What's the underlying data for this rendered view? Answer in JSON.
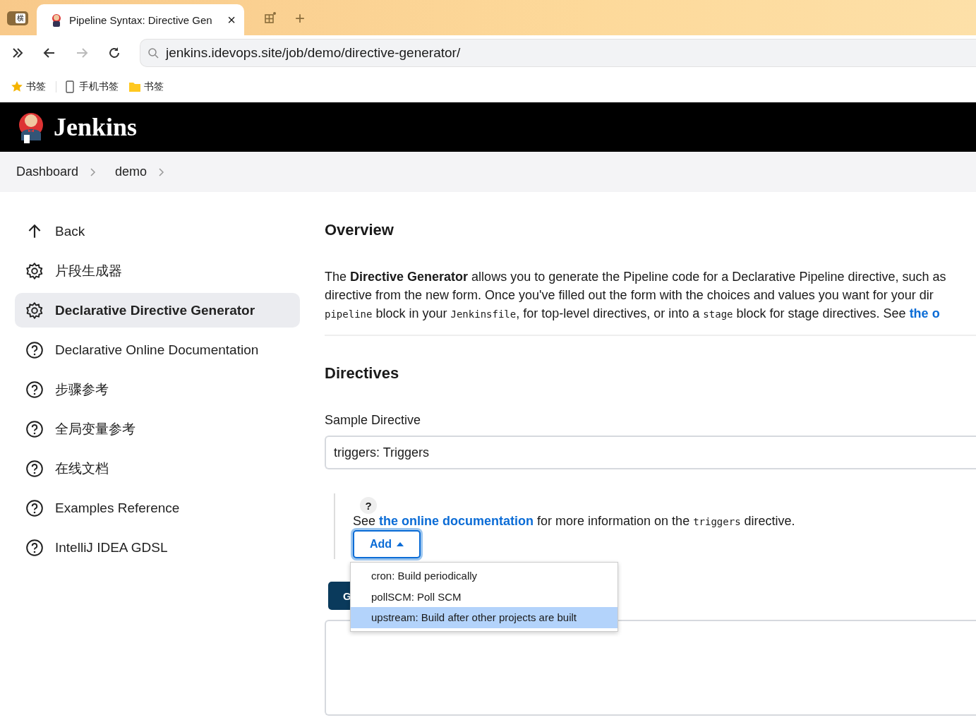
{
  "browser": {
    "tab": {
      "title": "Pipeline Syntax: Directive Gen",
      "close": "×"
    },
    "side_tab": "横",
    "new_tab": "+",
    "address": "jenkins.idevops.site/job/demo/directive-generator/",
    "bookmarks": [
      {
        "kind": "star",
        "label": "书签"
      },
      {
        "kind": "phone",
        "label": "手机书签"
      },
      {
        "kind": "folder",
        "label": "书签"
      }
    ]
  },
  "header": {
    "title": "Jenkins"
  },
  "breadcrumbs": [
    "Dashboard",
    "demo"
  ],
  "sidebar": {
    "items": [
      {
        "kind": "back",
        "label": "Back",
        "selected": false
      },
      {
        "kind": "generator",
        "label": "片段生成器",
        "selected": false
      },
      {
        "kind": "generator",
        "label": "Declarative Directive Generator",
        "selected": true
      },
      {
        "kind": "doc",
        "label": "Declarative Online Documentation",
        "selected": false
      },
      {
        "kind": "doc",
        "label": "步骤参考",
        "selected": false
      },
      {
        "kind": "doc",
        "label": "全局变量参考",
        "selected": false
      },
      {
        "kind": "doc",
        "label": "在线文档",
        "selected": false
      },
      {
        "kind": "doc",
        "label": "Examples Reference",
        "selected": false
      },
      {
        "kind": "doc",
        "label": "IntelliJ IDEA GDSL",
        "selected": false
      }
    ]
  },
  "overview": {
    "title": "Overview",
    "lines": [
      [
        {
          "kind": "text",
          "text": "The "
        },
        {
          "kind": "bold",
          "text": "Directive Generator"
        },
        {
          "kind": "text",
          "text": " allows you to generate the Pipeline code for a Declarative Pipeline directive, such as"
        }
      ],
      [
        {
          "kind": "text",
          "text": "directive from the new form. Once you've filled out the form with the choices and values you want for your dir"
        }
      ],
      [
        {
          "kind": "code",
          "text": "pipeline"
        },
        {
          "kind": "text",
          "text": " block in your "
        },
        {
          "kind": "code",
          "text": "Jenkinsfile"
        },
        {
          "kind": "text",
          "text": ", for top-level directives, or into a "
        },
        {
          "kind": "code",
          "text": "stage"
        },
        {
          "kind": "text",
          "text": " block for stage directives. See "
        },
        {
          "kind": "link",
          "text": "the o"
        }
      ]
    ]
  },
  "directives": {
    "title": "Directives",
    "field_label": "Sample Directive",
    "field_value": "triggers: Triggers",
    "help": "?",
    "help_text": [
      {
        "kind": "text",
        "text": "See "
      },
      {
        "kind": "link",
        "text": "the online documentation"
      },
      {
        "kind": "text",
        "text": " for more information on the "
      },
      {
        "kind": "code",
        "text": "triggers"
      },
      {
        "kind": "text",
        "text": " directive."
      }
    ],
    "add_button": {
      "label": "Add",
      "expanded": true
    },
    "menu": [
      {
        "label": "cron: Build periodically",
        "selected": false
      },
      {
        "label": "pollSCM: Poll SCM",
        "selected": false
      },
      {
        "label": "upstream: Build after other projects are built",
        "selected": true
      }
    ],
    "generate_button": "G"
  }
}
